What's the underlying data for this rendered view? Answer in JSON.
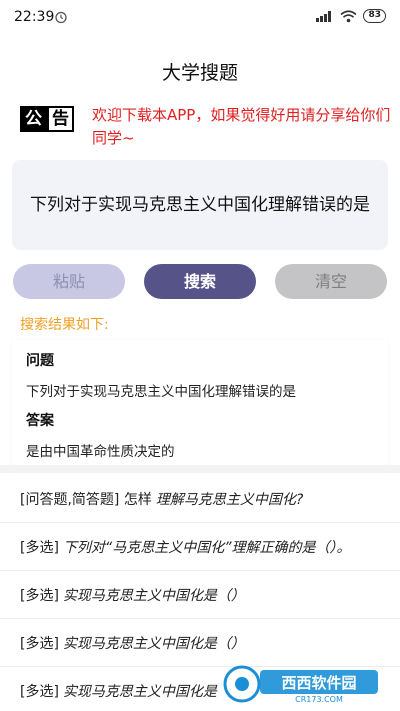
{
  "status_bar": {
    "time": "22:39",
    "battery": "83",
    "icons": [
      "alarm-icon",
      "signal-icon",
      "wifi-icon",
      "battery-icon"
    ]
  },
  "header": {
    "title": "大学搜题"
  },
  "notice": {
    "badge_left": "公",
    "badge_right": "告",
    "text": "欢迎下载本APP，如果觉得好用请分享给你们同学~",
    "color": "#e02020"
  },
  "question": {
    "text": "下列对于实现马克思主义中国化理解错误的是"
  },
  "buttons": {
    "paste": "粘贴",
    "search": "搜索",
    "clear": "清空"
  },
  "results": {
    "label": "搜索结果如下:",
    "question_heading": "问题",
    "question_text": "下列对于实现马克思主义中国化理解错误的是",
    "answer_heading": "答案",
    "answer_text": "是由中国革命性质决定的"
  },
  "related": [
    {
      "tag": "[问答题,简答题] 怎样",
      "text": "理解马克思主义中国化?"
    },
    {
      "tag": "[多选]",
      "text": "下列对“马克思主义中国化”理解正确的是（）。"
    },
    {
      "tag": "[多选]",
      "text": "实现马克思主义中国化是（）"
    },
    {
      "tag": "[多选]",
      "text": "实现马克思主义中国化是（）"
    },
    {
      "tag": "[多选]",
      "text": "实现马克思主义中国化是（）"
    }
  ],
  "watermark": {
    "text": "西西软件园",
    "site": "CR173.COM"
  },
  "colors": {
    "accent": "#565388",
    "results_label": "#f0a025"
  }
}
